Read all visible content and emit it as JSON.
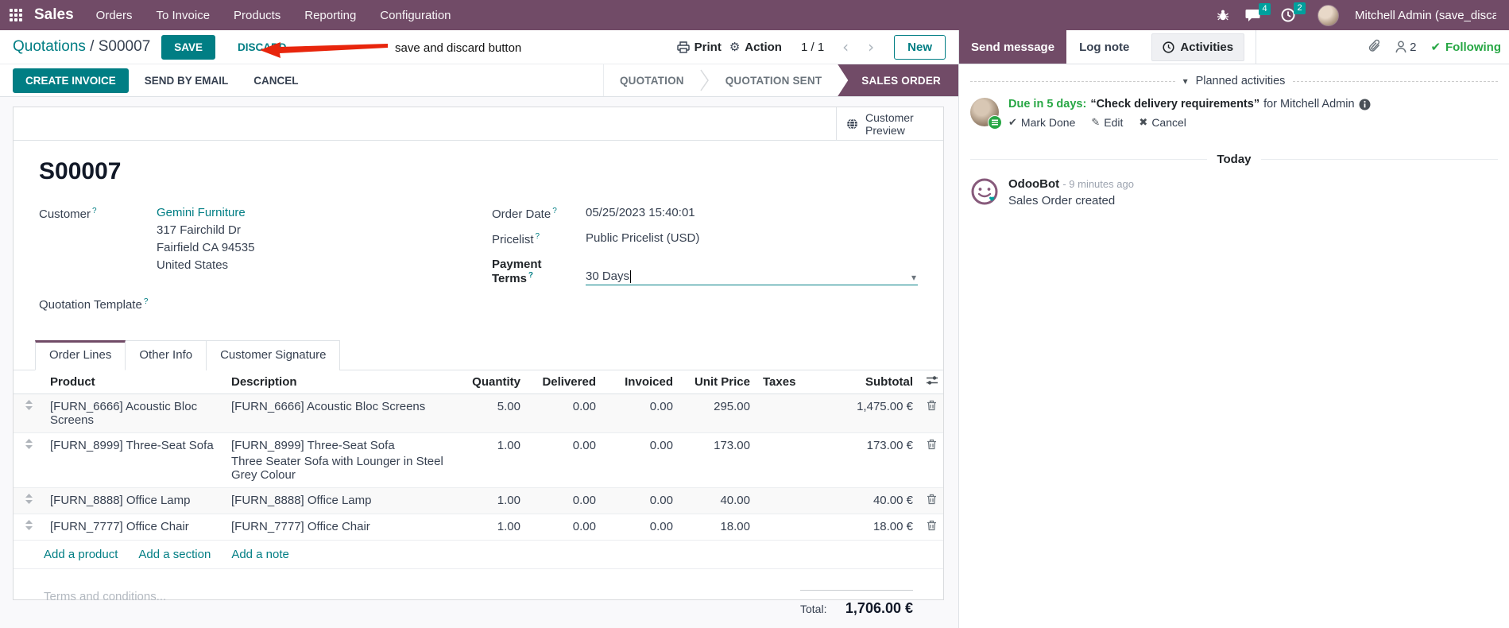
{
  "navbar": {
    "brand": "Sales",
    "menus": [
      "Orders",
      "To Invoice",
      "Products",
      "Reporting",
      "Configuration"
    ],
    "messages_badge": "4",
    "activities_badge": "2",
    "user_name": "Mitchell Admin (save_discar"
  },
  "breadcrumb": {
    "parent": "Quotations",
    "separator": " / ",
    "current": "S00007"
  },
  "control_panel": {
    "save": "SAVE",
    "discard": "DISCARD",
    "print": "Print",
    "action": "Action",
    "pager": "1 / 1",
    "new": "New"
  },
  "annotation": {
    "text": "save and discard button"
  },
  "statusbar": {
    "create_invoice": "CREATE INVOICE",
    "send_by_email": "SEND BY EMAIL",
    "cancel": "CANCEL",
    "steps": [
      {
        "label": "QUOTATION",
        "active": false
      },
      {
        "label": "QUOTATION SENT",
        "active": false
      },
      {
        "label": "SALES ORDER",
        "active": true
      }
    ]
  },
  "sheet": {
    "help": "?",
    "preview_button": "Customer Preview",
    "title": "S00007",
    "fields": {
      "customer": {
        "label": "Customer",
        "name": "Gemini Furniture",
        "address": [
          "317 Fairchild Dr",
          "Fairfield CA 94535",
          "United States"
        ]
      },
      "quotation_template": {
        "label": "Quotation Template",
        "value": ""
      },
      "order_date": {
        "label": "Order Date",
        "value": "05/25/2023 15:40:01"
      },
      "pricelist": {
        "label": "Pricelist",
        "value": "Public Pricelist (USD)"
      },
      "payment_terms": {
        "label": "Payment Terms",
        "value": "30 Days"
      }
    },
    "tabs": [
      {
        "label": "Order Lines",
        "active": true
      },
      {
        "label": "Other Info",
        "active": false
      },
      {
        "label": "Customer Signature",
        "active": false
      }
    ],
    "order_lines": {
      "columns": [
        "Product",
        "Description",
        "Quantity",
        "Delivered",
        "Invoiced",
        "Unit Price",
        "Taxes",
        "Subtotal"
      ],
      "rows": [
        {
          "product": "[FURN_6666] Acoustic Bloc Screens",
          "description": "[FURN_6666] Acoustic Bloc Screens",
          "description2": "",
          "quantity": "5.00",
          "delivered": "0.00",
          "invoiced": "0.00",
          "unit_price": "295.00",
          "taxes": "",
          "subtotal": "1,475.00 €",
          "highlight": false
        },
        {
          "product": "[FURN_8999] Three-Seat Sofa",
          "description": "[FURN_8999] Three-Seat Sofa",
          "description2": "Three Seater Sofa with Lounger in Steel Grey Colour",
          "quantity": "1.00",
          "delivered": "0.00",
          "invoiced": "0.00",
          "unit_price": "173.00",
          "taxes": "",
          "subtotal": "173.00 €",
          "highlight": true
        },
        {
          "product": "[FURN_8888] Office Lamp",
          "description": "[FURN_8888] Office Lamp",
          "description2": "",
          "quantity": "1.00",
          "delivered": "0.00",
          "invoiced": "0.00",
          "unit_price": "40.00",
          "taxes": "",
          "subtotal": "40.00 €",
          "highlight": false
        },
        {
          "product": "[FURN_7777] Office Chair",
          "description": "[FURN_7777] Office Chair",
          "description2": "",
          "quantity": "1.00",
          "delivered": "0.00",
          "invoiced": "0.00",
          "unit_price": "18.00",
          "taxes": "",
          "subtotal": "18.00 €",
          "highlight": false
        }
      ],
      "footer_links": [
        "Add a product",
        "Add a section",
        "Add a note"
      ]
    },
    "terms_placeholder": "Terms and conditions...",
    "total": {
      "label": "Total:",
      "value": "1,706.00 €"
    }
  },
  "chatter": {
    "send_message": "Send message",
    "log_note": "Log note",
    "activities": "Activities",
    "followers_count": "2",
    "following": "Following",
    "planned_activities": {
      "section_label": "Planned activities",
      "items": [
        {
          "due": "Due in 5 days:",
          "summary": "“Check delivery requirements”",
          "assignee": "for Mitchell Admin",
          "mark_done": "Mark Done",
          "edit": "Edit",
          "cancel": "Cancel"
        }
      ]
    },
    "today_label": "Today",
    "messages": [
      {
        "author": "OdooBot",
        "time": "- 9 minutes ago",
        "body": "Sales Order created"
      }
    ]
  },
  "icons": {
    "check": "✔",
    "pencil": "✎",
    "x": "✖",
    "caret_down": "▾",
    "chevron_left": "‹",
    "chevron_right": "›",
    "gear": "⚙"
  },
  "colors": {
    "navbar_bg": "#714B67",
    "primary_teal": "#017E84",
    "badge_teal": "#00A09D",
    "active_step_bg": "#714B67",
    "green": "#28a745",
    "annotation_red": "#e8250c"
  }
}
